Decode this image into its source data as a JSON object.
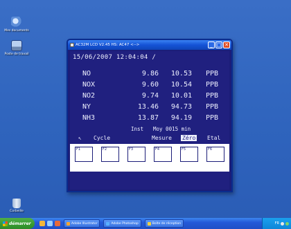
{
  "desktop": {
    "icons": [
      {
        "label": "Mes documents"
      },
      {
        "label": "Poste de travail"
      },
      {
        "label": "Corbeille"
      }
    ]
  },
  "window": {
    "title": "AC32M LCD V2.45 HS: AC47 <-->",
    "controls": {
      "minimize": "_",
      "maximize": "□",
      "close": "✕"
    }
  },
  "lcd": {
    "datetime": "15/06/2007 12:04:04 /",
    "rows": [
      {
        "name": "NO",
        "inst": "9.86",
        "avg": "10.53",
        "unit": "PPB"
      },
      {
        "name": "NOX",
        "inst": "9.60",
        "avg": "10.54",
        "unit": "PPB"
      },
      {
        "name": "NO2",
        "inst": "9.74",
        "avg": "10.01",
        "unit": "PPB"
      },
      {
        "name": "NY",
        "inst": "13.46",
        "avg": "94.73",
        "unit": "PPB"
      },
      {
        "name": "NH3",
        "inst": "13.87",
        "avg": "94.19",
        "unit": "PPB"
      }
    ],
    "caption_inst": "Inst",
    "caption_avg": "Moy 0015 min",
    "menu": {
      "arrow": "↖",
      "cycle": "Cycle",
      "mesure": "Mesure",
      "zero": "Zéro",
      "etal": "Etal"
    }
  },
  "fkeys": [
    "F1",
    "F2",
    "F3",
    "F4",
    "F5",
    "F6"
  ],
  "taskbar": {
    "start": "démarrer",
    "tasks": [
      "Adobe Illustrator",
      "Adobe Photoshop",
      "Boîte de réception"
    ],
    "tray": "FR"
  },
  "colors": {
    "desktop": "#3a6ec6",
    "lcd_bg": "#20207f",
    "lcd_text": "#eef0ff",
    "taskbar": "#2459d8",
    "start": "#379a30"
  }
}
